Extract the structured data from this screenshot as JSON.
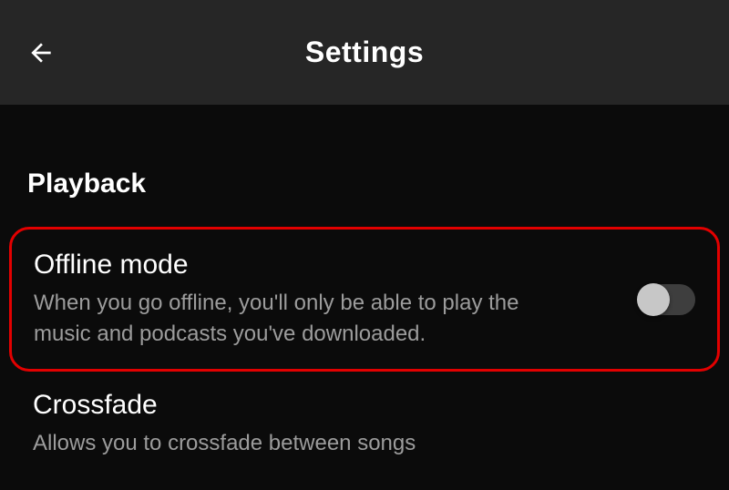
{
  "header": {
    "title": "Settings"
  },
  "section": {
    "title": "Playback"
  },
  "settings": {
    "offline": {
      "title": "Offline mode",
      "desc": "When you go offline, you'll only be able to play the music and podcasts you've downloaded.",
      "enabled": false
    },
    "crossfade": {
      "title": "Crossfade",
      "desc": "Allows you to crossfade between songs"
    }
  }
}
